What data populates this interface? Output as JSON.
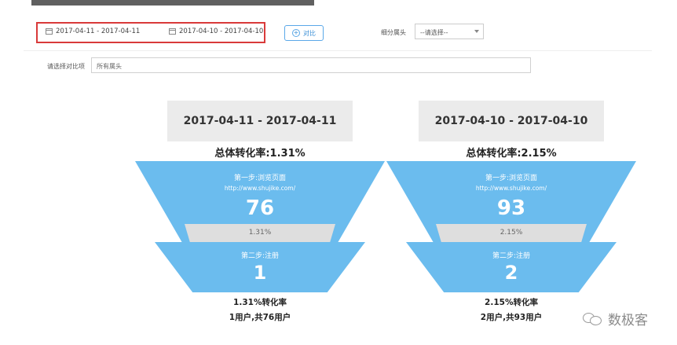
{
  "filters": {
    "date_range_1": "2017-04-11 - 2017-04-11",
    "date_range_2": "2017-04-10 - 2017-04-10",
    "compare_label": "对比",
    "segment_label": "细分属头",
    "segment_placeholder": "--请选择--",
    "compare_field_label": "请选择对比项",
    "compare_field_value": "所有属头"
  },
  "funnels": [
    {
      "range": "2017-04-11 - 2017-04-11",
      "total_rate": "总体转化率:1.31%",
      "step1": {
        "name": "第一步:浏览页面",
        "url": "http://www.shujike.com/",
        "value": "76"
      },
      "rate_between": "1.31%",
      "step2": {
        "name": "第二步:注册",
        "value": "1"
      },
      "conversion": "1.31%转化率",
      "users": "1用户,共76用户"
    },
    {
      "range": "2017-04-10 - 2017-04-10",
      "total_rate": "总体转化率:2.15%",
      "step1": {
        "name": "第一步:浏览页面",
        "url": "http://www.shujike.com/",
        "value": "93"
      },
      "rate_between": "2.15%",
      "step2": {
        "name": "第二步:注册",
        "value": "2"
      },
      "conversion": "2.15%转化率",
      "users": "2用户,共93用户"
    }
  ],
  "watermark": {
    "text": "数极客",
    "icon": "wechat-icon"
  },
  "colors": {
    "funnel_blue": "#6bbcee",
    "highlight_border": "#d93a3a",
    "accent": "#3a8fd6"
  }
}
